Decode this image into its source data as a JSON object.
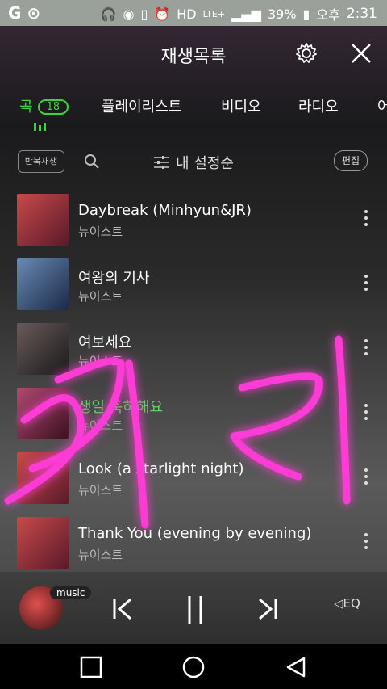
{
  "status": {
    "carrier_icons": "G ⊙",
    "battery": "39%",
    "ampm": "오후",
    "time": "2:31",
    "network": "LTE+"
  },
  "header": {
    "title": "재생목록"
  },
  "tabs": [
    {
      "label": "곡",
      "badge": "18",
      "active": true
    },
    {
      "label": "플레이리스트"
    },
    {
      "label": "비디오"
    },
    {
      "label": "라디오"
    },
    {
      "label": "어"
    }
  ],
  "toolbar": {
    "repeat_label": "반복재생",
    "sort_label": "내 설정순",
    "edit_label": "편집"
  },
  "songs": [
    {
      "title": "Daybreak (Minhyun&JR)",
      "artist": "뉴이스트",
      "cover_color": "#b03a3a"
    },
    {
      "title": "여왕의 기사",
      "artist": "뉴이스트",
      "cover_color": "#3a5a7a"
    },
    {
      "title": "여보세요",
      "artist": "뉴이스트",
      "cover_color": "#444444"
    },
    {
      "title": "생일 축하해요",
      "artist": "뉴이스트",
      "cover_color": "#8a2a40",
      "playing": true
    },
    {
      "title": "Look (a starlight night)",
      "artist": "뉴이스트",
      "cover_color": "#a04040"
    },
    {
      "title": "Thank You (evening by evening)",
      "artist": "뉴이스트",
      "cover_color": "#a04040"
    }
  ],
  "player": {
    "music_tag": "music",
    "eq_label": "EQ"
  },
  "overlay": {
    "handwriting": "기리",
    "color": "#ff3bd6"
  },
  "colors": {
    "accent": "#3fd23f"
  }
}
